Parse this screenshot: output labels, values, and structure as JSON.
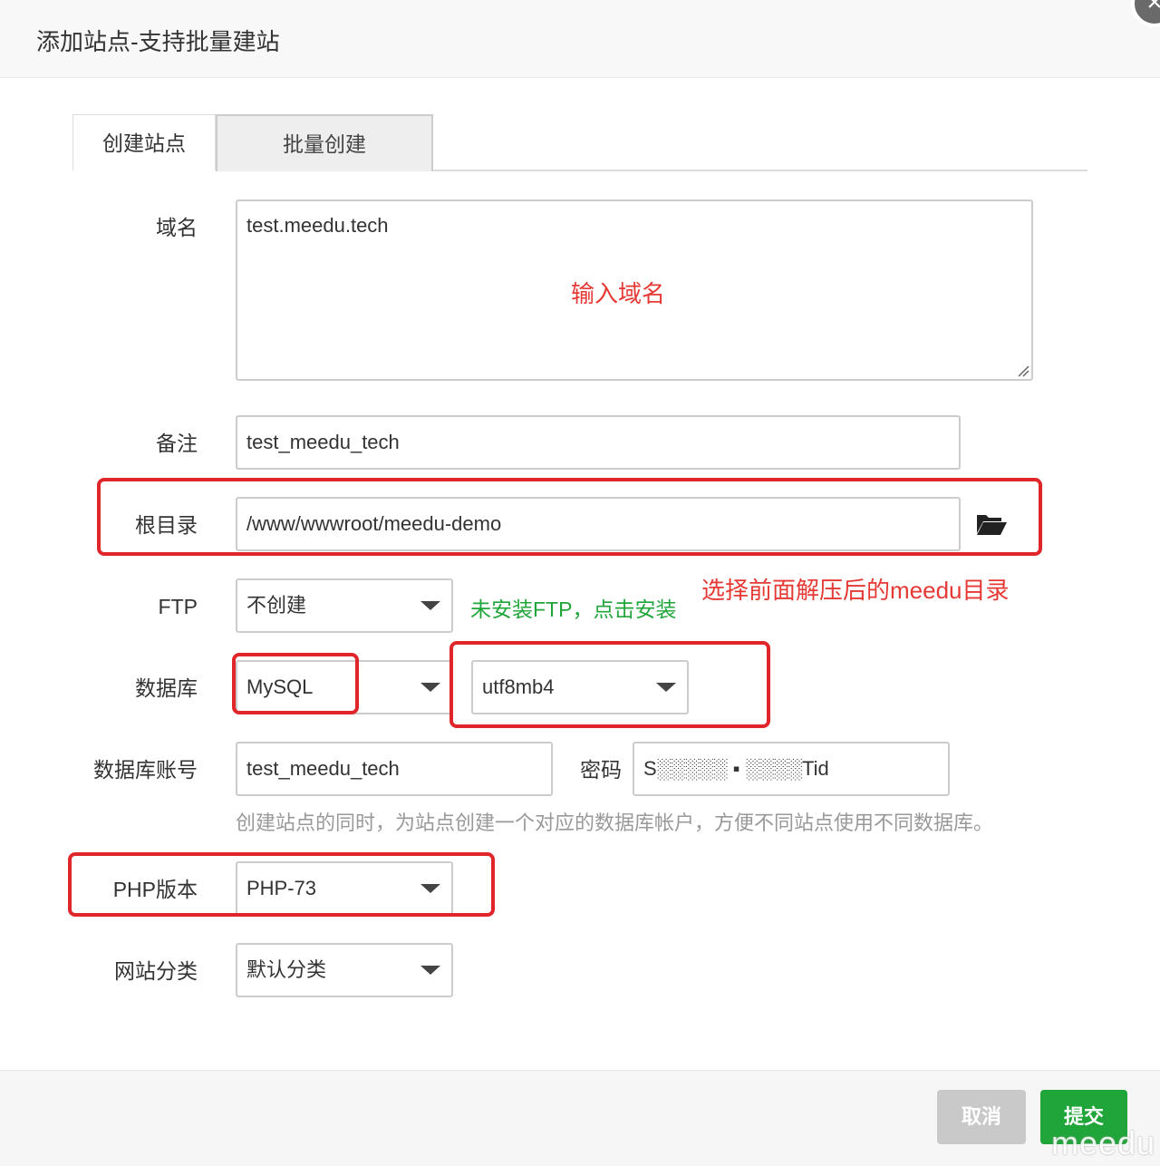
{
  "dialog": {
    "title": "添加站点-支持批量建站",
    "close_label": "×"
  },
  "tabs": [
    {
      "label": "创建站点",
      "active": true
    },
    {
      "label": "批量创建",
      "active": false
    }
  ],
  "form": {
    "domain": {
      "label": "域名",
      "value": "test.meedu.tech",
      "annotation": "输入域名"
    },
    "note": {
      "label": "备注",
      "value": "test_meedu_tech"
    },
    "root": {
      "label": "根目录",
      "value": "/www/wwwroot/meedu-demo",
      "annotation": "选择前面解压后的meedu目录"
    },
    "ftp": {
      "label": "FTP",
      "value": "不创建",
      "hint": "未安装FTP，点击安装"
    },
    "database": {
      "label": "数据库",
      "type": "MySQL",
      "charset": "utf8mb4"
    },
    "db_account": {
      "label": "数据库账号",
      "value": "test_meedu_tech",
      "password_label": "密码",
      "password_value": "S░░░░░ ▪ ░░░░Tid"
    },
    "db_help": "创建站点的同时，为站点创建一个对应的数据库帐户，方便不同站点使用不同数据库。",
    "php": {
      "label": "PHP版本",
      "value": "PHP-73"
    },
    "category": {
      "label": "网站分类",
      "value": "默认分类"
    }
  },
  "footer": {
    "cancel_label": "取消",
    "submit_label": "提交"
  },
  "watermark": "meedu",
  "colors": {
    "accent_green": "#20a53a",
    "annotation_red": "#e53935",
    "highlight_red": "#e0262b"
  },
  "icons": [
    "close-icon",
    "folder-open-icon",
    "chevron-down-icon",
    "resize-grip-icon"
  ]
}
